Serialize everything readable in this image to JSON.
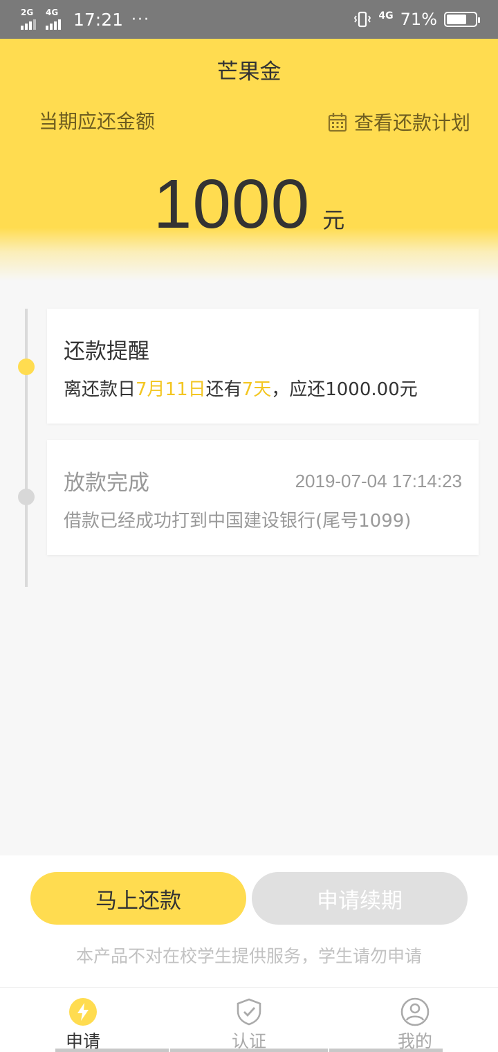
{
  "status_bar": {
    "signal1": "2G",
    "signal2": "4G",
    "time": "17:21",
    "dots": "···",
    "network": "4G",
    "battery": "71%",
    "battery_level": 0.71
  },
  "header": {
    "title": "芒果金",
    "due_label": "当期应还金额",
    "plan_link": "查看还款计划",
    "plan_icon": "calendar-icon",
    "amount": "1000",
    "unit": "元"
  },
  "timeline": {
    "reminder": {
      "title": "还款提醒",
      "text_prefix": "离还款日",
      "date": "7月11日",
      "text_mid": "还有",
      "days": "7天",
      "text_suffix": "，应还1000.00元"
    },
    "completed": {
      "title": "放款完成",
      "time": "2019-07-04 17:14:23",
      "text": "借款已经成功打到中国建设银行(尾号1099)"
    }
  },
  "actions": {
    "repay": "马上还款",
    "renew": "申请续期",
    "notice": "本产品不对在校学生提供服务，学生请勿申请"
  },
  "tabs": [
    {
      "label": "申请",
      "icon": "lightning-icon",
      "active": true
    },
    {
      "label": "认证",
      "icon": "shield-check-icon",
      "active": false
    },
    {
      "label": "我的",
      "icon": "user-icon",
      "active": false
    }
  ],
  "colors": {
    "brand_yellow": "#ffdc50",
    "highlight": "#f3c622",
    "muted": "#999999"
  }
}
